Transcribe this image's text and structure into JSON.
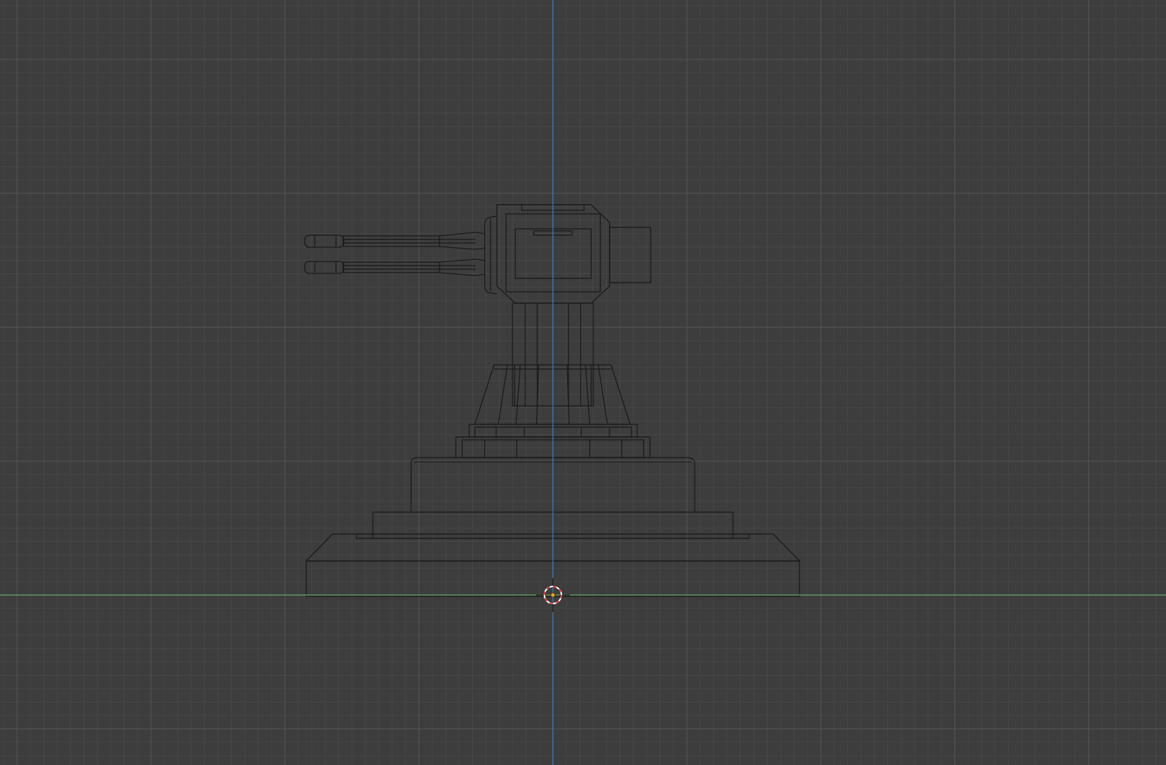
{
  "viewport": {
    "view": "front-orthographic",
    "shading": "wireframe",
    "object": "turret-model"
  },
  "colors": {
    "background": "#3d3d3d",
    "grid_minor": "#474747",
    "grid_major": "#555555",
    "axis_z": "#3f7fbf",
    "axis_x": "#5b9a5b",
    "wireframe": "#1a1a1a",
    "cursor_red": "#e03a3a",
    "cursor_white": "#ffffff",
    "origin": "#f0a020"
  },
  "icons": {
    "cursor": "3d-cursor-icon",
    "origin": "object-origin-icon"
  }
}
